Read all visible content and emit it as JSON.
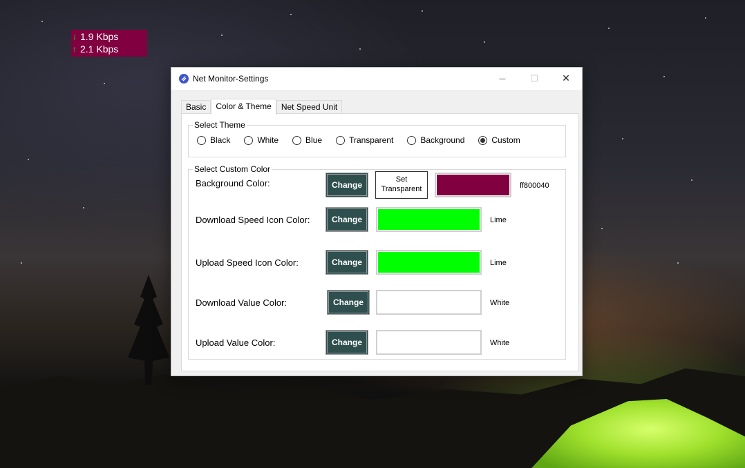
{
  "widget": {
    "download": "1.9 Kbps",
    "upload": "2.1 Kbps",
    "arrow_down": "↓",
    "arrow_up": "↑",
    "background_color": "#800040",
    "icon_color": "#00ff00"
  },
  "window": {
    "title": "Net Monitor-Settings",
    "minimize_glyph": "—",
    "maximize_glyph": "☐",
    "close_glyph": "✕"
  },
  "tabs": [
    {
      "label": "Basic"
    },
    {
      "label": "Color & Theme"
    },
    {
      "label": "Net Speed Unit"
    }
  ],
  "select_theme": {
    "legend": "Select Theme",
    "options": [
      {
        "label": "Black",
        "checked": false
      },
      {
        "label": "White",
        "checked": false
      },
      {
        "label": "Blue",
        "checked": false
      },
      {
        "label": "Transparent",
        "checked": false
      },
      {
        "label": "Background",
        "checked": false
      },
      {
        "label": "Custom",
        "checked": true
      }
    ]
  },
  "custom_color": {
    "legend": "Select Custom Color",
    "change_label": "Change",
    "set_transparent_label": "Set Transparent",
    "rows": [
      {
        "label": "Background Color:",
        "color_name": "ff800040",
        "swatch": "#800040"
      },
      {
        "label": "Download Speed Icon Color:",
        "color_name": "Lime",
        "swatch": "#00ff00"
      },
      {
        "label": "Upload Speed Icon Color:",
        "color_name": "Lime",
        "swatch": "#00ff00"
      },
      {
        "label": "Download Value Color:",
        "color_name": "White",
        "swatch": "#ffffff"
      },
      {
        "label": "Upload Value Color:",
        "color_name": "White",
        "swatch": "#ffffff"
      }
    ]
  },
  "colors": {
    "button_bg": "#2f4f4f",
    "accent": "#3f56c8"
  }
}
